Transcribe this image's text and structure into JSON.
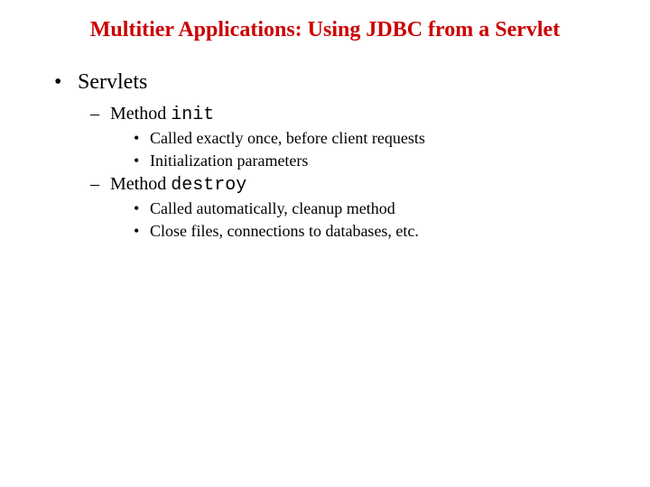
{
  "title": "Multitier Applications: Using JDBC from a Servlet",
  "l1": {
    "text": "Servlets"
  },
  "l2a": {
    "prefix": "Method ",
    "code": "init"
  },
  "l3a1": "Called exactly once, before client requests",
  "l3a2": "Initialization parameters",
  "l2b": {
    "prefix": "Method ",
    "code": "destroy"
  },
  "l3b1": "Called automatically, cleanup method",
  "l3b2": "Close files, connections to databases, etc."
}
